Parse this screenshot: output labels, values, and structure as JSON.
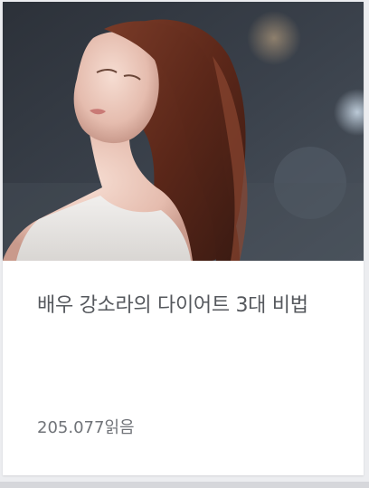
{
  "article": {
    "title": "배우 강소라의 다이어트 3대 비법",
    "views": "205.077",
    "views_suffix": "읽음",
    "image_alt": "actress-portrait-photo"
  },
  "colors": {
    "card_background": "#ffffff",
    "page_background": "#ecedf0",
    "title_text": "#55585d",
    "meta_text": "#707378"
  }
}
